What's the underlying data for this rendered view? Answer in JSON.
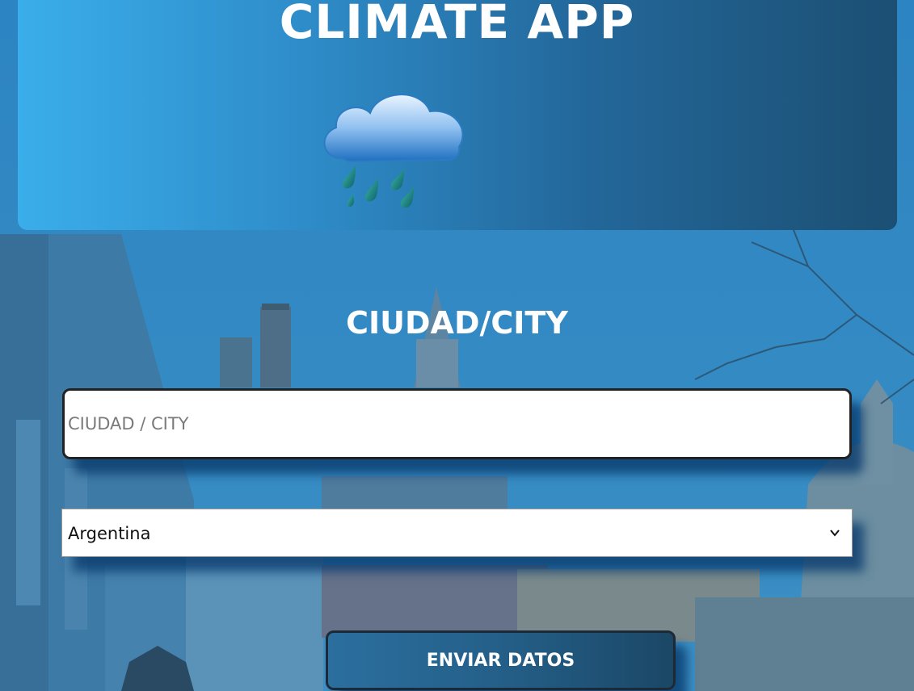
{
  "header": {
    "title": "CLIMATE APP",
    "weather_icon": "rain-cloud-icon"
  },
  "form": {
    "heading": "CIUDAD/CITY",
    "city_input": {
      "placeholder": "CIUDAD / CITY",
      "value": ""
    },
    "country_select": {
      "selected": "Argentina",
      "icon": "chevron-down-icon"
    },
    "submit_label": "ENVIAR DATOS"
  },
  "colors": {
    "header_gradient_start": "#3aaeea",
    "header_gradient_end": "#1c4f73",
    "button_bg": "#245f88",
    "text": "#ffffff"
  }
}
